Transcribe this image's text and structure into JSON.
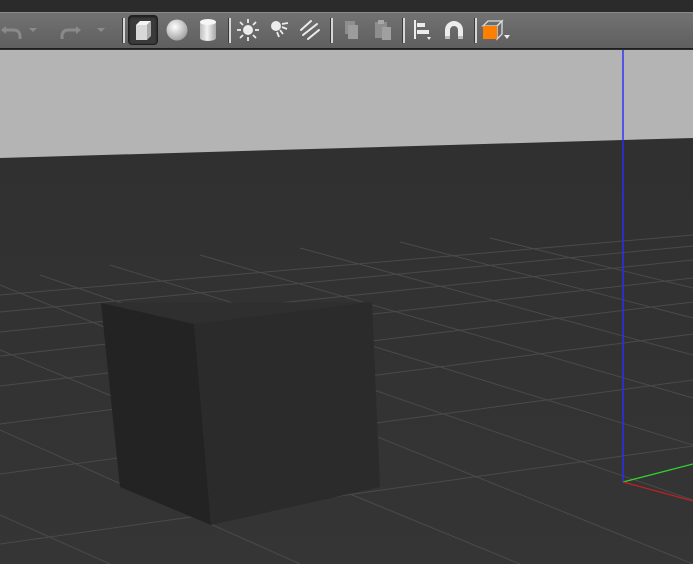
{
  "app": {
    "accent_color": "#ff8000",
    "background_sky": "#b4b4b4",
    "ground_color": "#343434"
  },
  "toolbar": {
    "buttons": [
      {
        "id": "undo",
        "icon": "undo-icon",
        "enabled": false
      },
      {
        "id": "undo-history",
        "icon": "chevron-down-icon",
        "enabled": false
      },
      {
        "id": "redo",
        "icon": "redo-icon",
        "enabled": false
      },
      {
        "id": "redo-history",
        "icon": "chevron-down-icon",
        "enabled": false
      },
      {
        "id": "box",
        "icon": "box-shape-icon",
        "active": true
      },
      {
        "id": "sphere",
        "icon": "sphere-shape-icon"
      },
      {
        "id": "cylinder",
        "icon": "cylinder-shape-icon"
      },
      {
        "id": "point-light",
        "icon": "point-light-icon"
      },
      {
        "id": "spot-light",
        "icon": "spot-light-icon"
      },
      {
        "id": "directional-light",
        "icon": "directional-light-icon"
      },
      {
        "id": "copy",
        "icon": "copy-icon",
        "enabled": false
      },
      {
        "id": "paste",
        "icon": "paste-icon",
        "enabled": false
      },
      {
        "id": "align",
        "icon": "align-icon"
      },
      {
        "id": "snap",
        "icon": "magnet-icon"
      },
      {
        "id": "view-angle",
        "icon": "view-angle-cube-icon"
      }
    ]
  }
}
